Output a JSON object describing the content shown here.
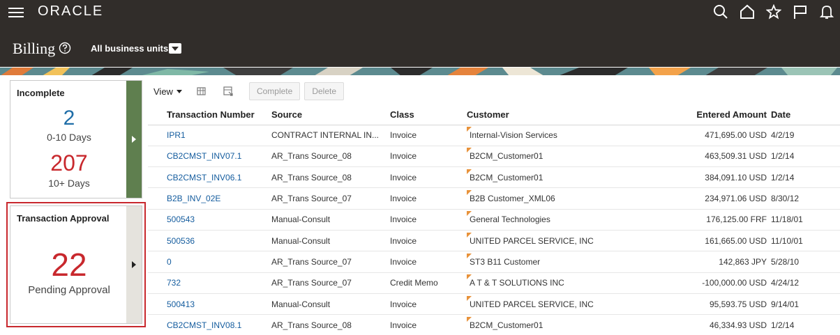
{
  "header": {
    "brand": "ORACLE",
    "page_title": "Billing",
    "business_unit": "All business units"
  },
  "icons": {
    "top": [
      "search-icon",
      "home-icon",
      "star-icon",
      "flag-icon",
      "notifications-icon"
    ]
  },
  "infolets": {
    "incomplete": {
      "title": "Incomplete",
      "count_a": "2",
      "label_a": "0-10 Days",
      "count_b": "207",
      "label_b": "10+ Days"
    },
    "approval": {
      "title": "Transaction Approval",
      "count": "22",
      "label": "Pending Approval"
    }
  },
  "toolbar": {
    "view_label": "View",
    "complete_label": "Complete",
    "delete_label": "Delete"
  },
  "table": {
    "columns": {
      "number": "Transaction Number",
      "source": "Source",
      "class": "Class",
      "customer": "Customer",
      "amount": "Entered Amount",
      "date": "Date"
    },
    "rows": [
      {
        "number": "IPR1",
        "source": "CONTRACT INTERNAL IN...",
        "class": "Invoice",
        "customer": "Internal-Vision Services",
        "amount": "471,695.00 USD",
        "date": "4/2/19"
      },
      {
        "number": "CB2CMST_INV07.1",
        "source": "AR_Trans Source_08",
        "class": "Invoice",
        "customer": "B2CM_Customer01",
        "amount": "463,509.31 USD",
        "date": "1/2/14"
      },
      {
        "number": "CB2CMST_INV06.1",
        "source": "AR_Trans Source_08",
        "class": "Invoice",
        "customer": "B2CM_Customer01",
        "amount": "384,091.10 USD",
        "date": "1/2/14"
      },
      {
        "number": "B2B_INV_02E",
        "source": "AR_Trans Source_07",
        "class": "Invoice",
        "customer": "B2B Customer_XML06",
        "amount": "234,971.06 USD",
        "date": "8/30/12"
      },
      {
        "number": "500543",
        "source": "Manual-Consult",
        "class": "Invoice",
        "customer": "General Technologies",
        "amount": "176,125.00 FRF",
        "date": "11/18/01"
      },
      {
        "number": "500536",
        "source": "Manual-Consult",
        "class": "Invoice",
        "customer": "UNITED PARCEL SERVICE, INC",
        "amount": "161,665.00 USD",
        "date": "11/10/01"
      },
      {
        "number": "0",
        "source": "AR_Trans Source_07",
        "class": "Invoice",
        "customer": "ST3 B11 Customer",
        "amount": "142,863 JPY",
        "date": "5/28/10"
      },
      {
        "number": "732",
        "source": "AR_Trans Source_07",
        "class": "Credit Memo",
        "customer": "A T & T SOLUTIONS INC",
        "amount": "-100,000.00 USD",
        "date": "4/24/12"
      },
      {
        "number": "500413",
        "source": "Manual-Consult",
        "class": "Invoice",
        "customer": "UNITED PARCEL SERVICE, INC",
        "amount": "95,593.75 USD",
        "date": "9/14/01"
      },
      {
        "number": "CB2CMST_INV08.1",
        "source": "AR_Trans Source_08",
        "class": "Invoice",
        "customer": "B2CM_Customer01",
        "amount": "46,334.93 USD",
        "date": "1/2/14"
      }
    ]
  },
  "colors": {
    "header_bg": "#312d2a",
    "link": "#145c9e",
    "alert_red": "#c8282d",
    "count_blue": "#1f6ea8",
    "infolet_tab_green": "#5f7f4f"
  }
}
